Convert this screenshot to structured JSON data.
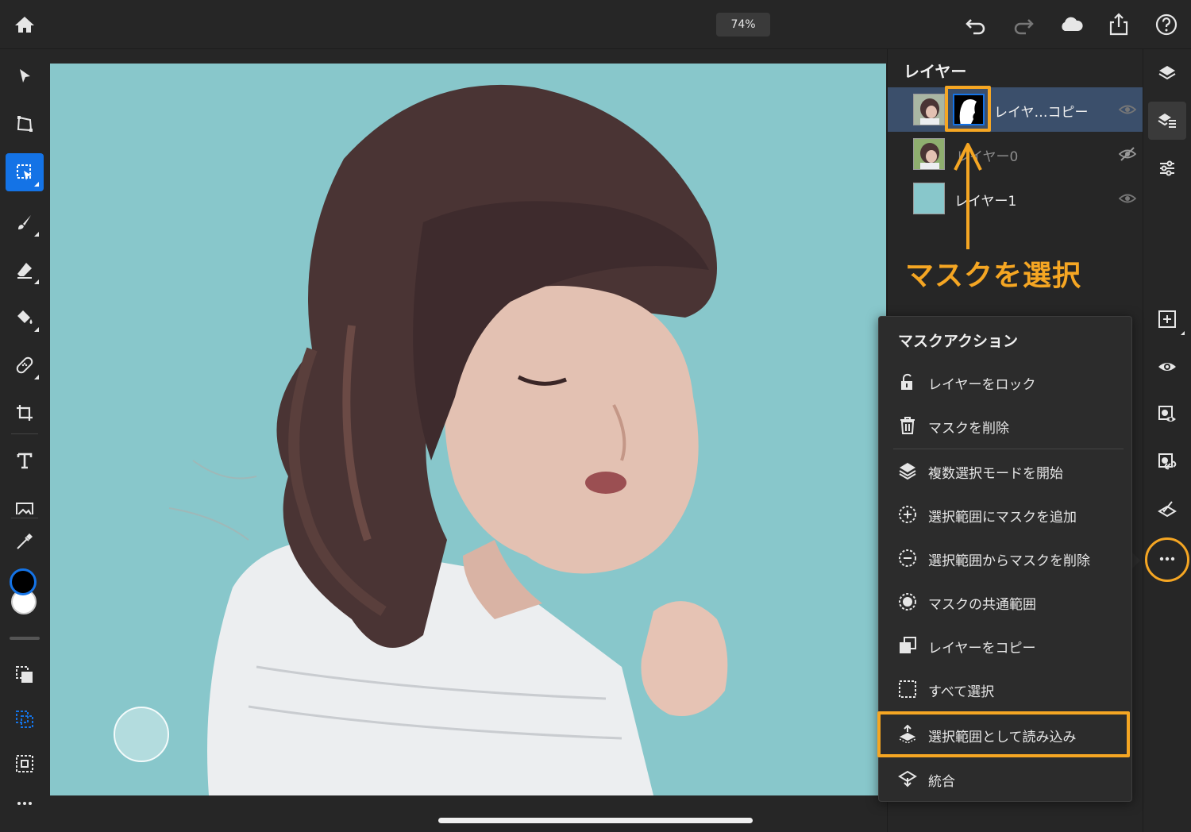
{
  "topbar": {
    "zoom_label": "74%",
    "icons": [
      "home-icon",
      "undo-icon",
      "redo-icon",
      "cloud-icon",
      "share-icon",
      "help-icon"
    ]
  },
  "toolbar": {
    "tools": [
      "move-tool-icon",
      "transform-tool-icon",
      "selection-tool-icon",
      "brush-tool-icon",
      "eraser-tool-icon",
      "fill-tool-icon",
      "healing-tool-icon",
      "crop-tool-icon",
      "type-tool-icon",
      "image-tool-icon",
      "eyedropper-tool-icon"
    ],
    "foreground_color": "#000000",
    "background_color": "#ffffff"
  },
  "layers_panel": {
    "title": "レイヤー",
    "layers": [
      {
        "name": "レイヤ…コピー",
        "visible": true,
        "selected": true
      },
      {
        "name": "レイヤー0",
        "visible": false,
        "selected": false
      },
      {
        "name": "レイヤー1",
        "visible": true,
        "selected": false
      }
    ]
  },
  "annotation": {
    "label": "マスクを選択",
    "color": "#f5a623"
  },
  "mask_actions": {
    "title": "マスクアクション",
    "items": [
      {
        "label": "レイヤーをロック",
        "icon": "lock-icon"
      },
      {
        "label": "マスクを削除",
        "icon": "trash-icon"
      },
      {
        "label": "複数選択モードを開始",
        "icon": "layers-stack-icon"
      },
      {
        "label": "選択範囲にマスクを追加",
        "icon": "add-circle-icon"
      },
      {
        "label": "選択範囲からマスクを削除",
        "icon": "subtract-circle-icon"
      },
      {
        "label": "マスクの共通範囲",
        "icon": "intersect-icon"
      },
      {
        "label": "レイヤーをコピー",
        "icon": "copy-layer-icon"
      },
      {
        "label": "すべて選択",
        "icon": "select-all-icon"
      },
      {
        "label": "選択範囲として読み込み",
        "icon": "load-selection-icon"
      },
      {
        "label": "統合",
        "icon": "merge-icon"
      }
    ]
  },
  "colors": {
    "canvas_background": "#88c7cb",
    "accent": "#1473e6",
    "highlight": "#f5a623"
  }
}
